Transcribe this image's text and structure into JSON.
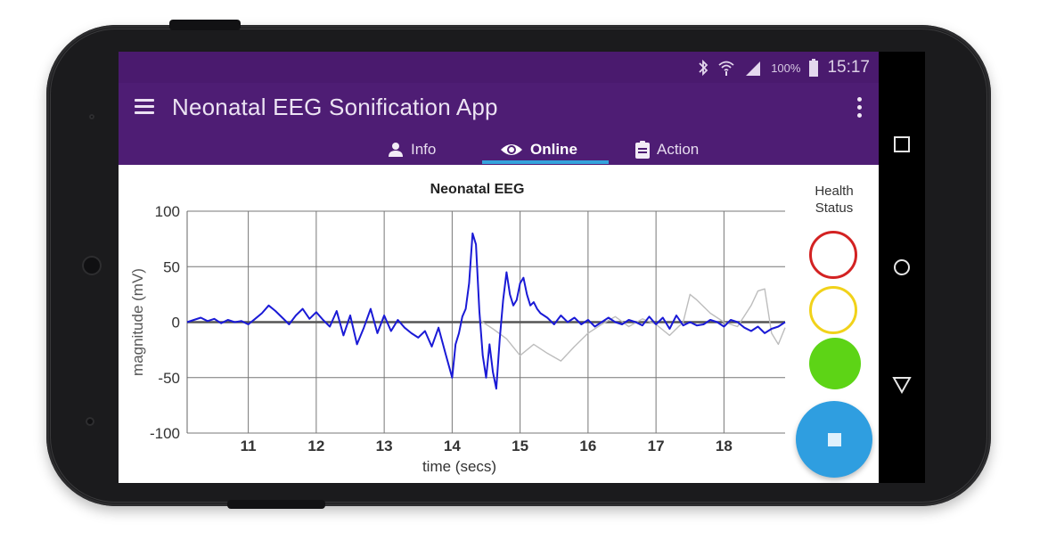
{
  "status_bar": {
    "battery_pct": "100%",
    "time": "15:17",
    "icons": [
      "bluetooth-icon",
      "wifi-icon",
      "signal-icon",
      "battery-icon"
    ]
  },
  "app_bar": {
    "title": "Neonatal EEG Sonification App",
    "menu_icon": "hamburger-menu-icon",
    "overflow_icon": "more-vert-icon"
  },
  "tabs": [
    {
      "label": "Info",
      "icon": "person-icon",
      "active": false
    },
    {
      "label": "Online",
      "icon": "eye-icon",
      "active": true
    },
    {
      "label": "Action",
      "icon": "clipboard-icon",
      "active": false
    }
  ],
  "health": {
    "label_line1": "Health",
    "label_line2": "Status",
    "indicators": [
      {
        "name": "red",
        "color": "#d32222",
        "filled": false
      },
      {
        "name": "yellow",
        "color": "#f1d21a",
        "filled": false
      },
      {
        "name": "green",
        "color": "#5dd416",
        "filled": true
      }
    ]
  },
  "fab": {
    "icon": "stop-icon",
    "color": "#2f9ee0"
  },
  "colors": {
    "status_bar": "#4a1a6e",
    "app_bar": "#4e1d74",
    "tab_indicator": "#34a3dc",
    "eeg_trace": "#1a1ad6",
    "secondary_trace": "#bdbdbd"
  },
  "chart_data": {
    "type": "line",
    "title": "Neonatal EEG",
    "xlabel": "time (secs)",
    "ylabel": "magnitude (mV)",
    "xlim": [
      10.1,
      18.9
    ],
    "ylim": [
      -100,
      100
    ],
    "xticks": [
      11,
      12,
      13,
      14,
      15,
      16,
      17,
      18
    ],
    "yticks": [
      100,
      50,
      0,
      -50,
      -100
    ],
    "grid": true,
    "series": [
      {
        "color": "#1a1ad6",
        "x": [
          10.1,
          10.2,
          10.3,
          10.4,
          10.5,
          10.6,
          10.7,
          10.8,
          10.9,
          11.0,
          11.1,
          11.2,
          11.3,
          11.4,
          11.5,
          11.6,
          11.7,
          11.8,
          11.9,
          12.0,
          12.1,
          12.2,
          12.3,
          12.4,
          12.5,
          12.6,
          12.7,
          12.8,
          12.9,
          13.0,
          13.1,
          13.2,
          13.3,
          13.4,
          13.5,
          13.6,
          13.7,
          13.8,
          13.9,
          14.0,
          14.05,
          14.1,
          14.15,
          14.2,
          14.25,
          14.3,
          14.35,
          14.4,
          14.45,
          14.5,
          14.55,
          14.6,
          14.65,
          14.7,
          14.75,
          14.8,
          14.85,
          14.9,
          14.95,
          15.0,
          15.05,
          15.1,
          15.15,
          15.2,
          15.25,
          15.3,
          15.4,
          15.5,
          15.6,
          15.7,
          15.8,
          15.9,
          16.0,
          16.1,
          16.2,
          16.3,
          16.4,
          16.5,
          16.6,
          16.7,
          16.8,
          16.9,
          17.0,
          17.1,
          17.2,
          17.3,
          17.4,
          17.5,
          17.6,
          17.7,
          17.8,
          17.9,
          18.0,
          18.1,
          18.2,
          18.3,
          18.4,
          18.5,
          18.6,
          18.7,
          18.8,
          18.9
        ],
        "y": [
          0,
          2,
          4,
          1,
          3,
          -1,
          2,
          0,
          1,
          -2,
          3,
          8,
          15,
          10,
          4,
          -2,
          6,
          12,
          3,
          9,
          2,
          -4,
          10,
          -12,
          6,
          -20,
          -5,
          12,
          -10,
          6,
          -8,
          2,
          -5,
          -10,
          -14,
          -8,
          -22,
          -5,
          -28,
          -50,
          -20,
          -10,
          5,
          12,
          35,
          80,
          70,
          10,
          -30,
          -50,
          -20,
          -45,
          -60,
          -15,
          20,
          45,
          25,
          15,
          20,
          35,
          40,
          25,
          15,
          18,
          12,
          8,
          4,
          -2,
          6,
          0,
          4,
          -2,
          2,
          -4,
          0,
          4,
          0,
          -2,
          2,
          0,
          -3,
          5,
          -2,
          4,
          -6,
          6,
          -3,
          0,
          -3,
          -2,
          2,
          0,
          -4,
          2,
          0,
          -5,
          -8,
          -4,
          -10,
          -6,
          -4,
          0
        ]
      },
      {
        "color": "#bdbdbd",
        "x": [
          14.4,
          14.6,
          14.8,
          15.0,
          15.2,
          15.4,
          15.6,
          15.8,
          16.0,
          16.2,
          16.4,
          16.6,
          16.8,
          17.0,
          17.2,
          17.4,
          17.5,
          17.6,
          17.8,
          18.0,
          18.2,
          18.4,
          18.5,
          18.6,
          18.7,
          18.8,
          18.9
        ],
        "y": [
          2,
          -6,
          -15,
          -30,
          -20,
          -28,
          -35,
          -22,
          -10,
          -2,
          5,
          -4,
          3,
          -2,
          -12,
          0,
          25,
          20,
          8,
          0,
          -4,
          15,
          28,
          30,
          -10,
          -20,
          -5
        ]
      }
    ],
    "baseline": 0
  }
}
